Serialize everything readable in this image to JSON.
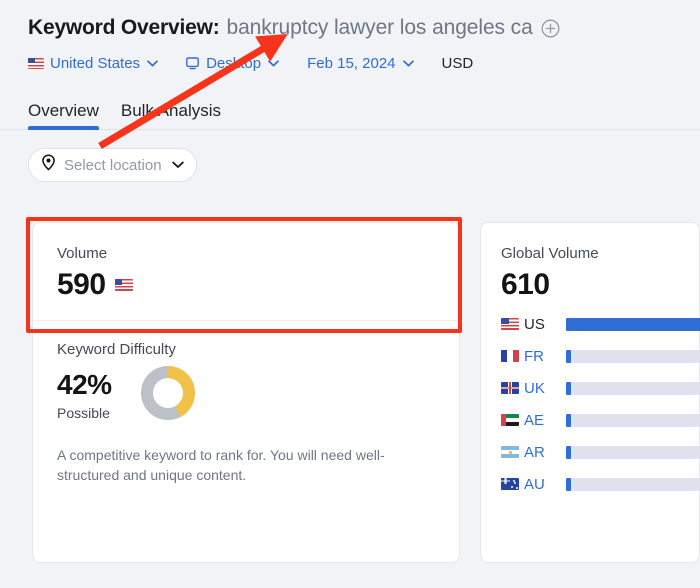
{
  "header": {
    "title_prefix": "Keyword Overview:",
    "keyword": "bankruptcy lawyer los angeles ca",
    "add_keyword_icon": "circle-plus-icon"
  },
  "filters": {
    "country": {
      "label": "United States",
      "flag": "us-flag-icon",
      "caret": "chevron-down-icon"
    },
    "device": {
      "label": "Desktop",
      "icon": "desktop-icon",
      "caret": "chevron-down-icon"
    },
    "date": {
      "label": "Feb 15, 2024",
      "caret": "chevron-down-icon"
    },
    "currency": {
      "label": "USD"
    }
  },
  "tabs": [
    {
      "label": "Overview",
      "active": true
    },
    {
      "label": "Bulk Analysis",
      "active": false
    }
  ],
  "location_select": {
    "icon": "map-pin-icon",
    "placeholder": "Select location",
    "caret": "chevron-down-icon"
  },
  "volume_card": {
    "label": "Volume",
    "value": "590",
    "flag": "us-flag-icon"
  },
  "keyword_difficulty": {
    "label": "Keyword Difficulty",
    "percent": "42%",
    "status": "Possible",
    "description": "A competitive keyword to rank for. You will need well-structured and unique content.",
    "donut_value": 42,
    "donut_color": "#f0c248",
    "donut_track_color": "#bcc0c7"
  },
  "global_volume": {
    "label": "Global Volume",
    "value": "610",
    "rows": [
      {
        "code": "US",
        "flag": "us-flag-icon",
        "pct": 100,
        "current": true
      },
      {
        "code": "FR",
        "flag": "fr-flag-icon",
        "pct": 2.6,
        "current": false
      },
      {
        "code": "UK",
        "flag": "uk-flag-icon",
        "pct": 2.6,
        "current": false
      },
      {
        "code": "AE",
        "flag": "ae-flag-icon",
        "pct": 2.6,
        "current": false
      },
      {
        "code": "AR",
        "flag": "ar-flag-icon",
        "pct": 2.6,
        "current": false
      },
      {
        "code": "AU",
        "flag": "au-flag-icon",
        "pct": 2.6,
        "current": false
      }
    ]
  },
  "annotations": {
    "highlight_color": "#f5341b",
    "arrow_color": "#f5341b",
    "highlight_target": "volume-card",
    "arrow_target": "keyword-title"
  },
  "colors": {
    "accent_blue": "#2f6ed5",
    "page_background": "#f1f3f7",
    "card_background": "#ffffff",
    "bar_track": "#dfe2ec"
  }
}
